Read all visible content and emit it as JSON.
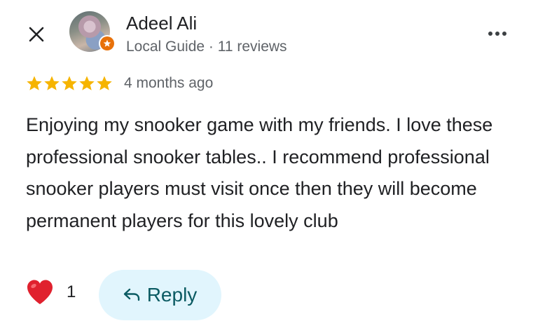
{
  "colors": {
    "star": "#f6b400",
    "heart": "#e0212e",
    "reply_bg": "#e1f5fd",
    "reply_text": "#0b5b63",
    "badge": "#e8710a"
  },
  "icons": {
    "close": "close-icon",
    "more": "more-horiz-icon",
    "star": "star-icon",
    "heart": "heart-icon",
    "reply": "reply-arrow-icon",
    "badge": "local-guide-badge-icon"
  },
  "reviewer": {
    "name": "Adeel Ali",
    "subtitle": "Local Guide · 11 reviews"
  },
  "review": {
    "rating": 5,
    "rating_max": 5,
    "time_ago": "4 months ago",
    "text": "Enjoying my snooker game with my friends. I love these professional snooker tables.. I recommend professional snooker players must visit once then they will become permanent players for this lovely club"
  },
  "actions": {
    "like_count": "1",
    "reply_label": "Reply"
  }
}
